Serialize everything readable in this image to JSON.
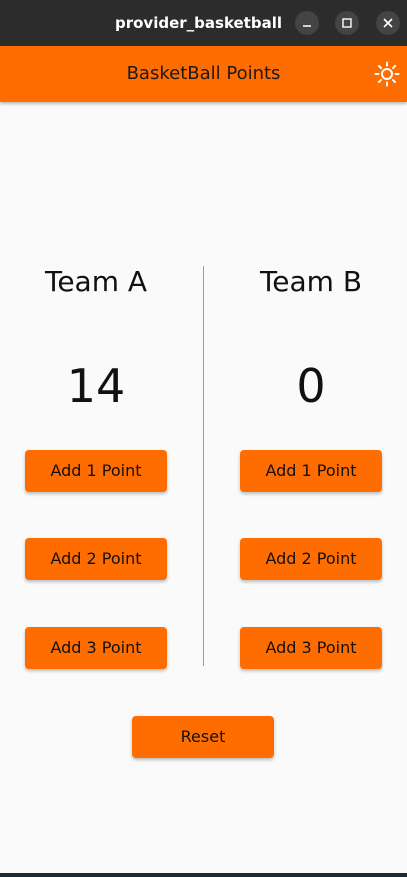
{
  "window": {
    "title": "provider_basketball",
    "controls": {
      "minimize_icon": "minimize-icon",
      "maximize_icon": "maximize-icon",
      "close_icon": "close-icon"
    }
  },
  "appbar": {
    "title": "BasketBall Points",
    "action_icon": "sun-icon",
    "color": "#ff6d00"
  },
  "teams": [
    {
      "name": "Team A",
      "score": "14",
      "buttons": [
        "Add 1 Point",
        "Add 2 Point",
        "Add 3 Point"
      ]
    },
    {
      "name": "Team B",
      "score": "0",
      "buttons": [
        "Add 1 Point",
        "Add 2 Point",
        "Add 3 Point"
      ]
    }
  ],
  "reset_label": "Reset",
  "colors": {
    "accent": "#ff6d00",
    "background": "#fafafa",
    "titlebar": "#2c2c2c"
  }
}
